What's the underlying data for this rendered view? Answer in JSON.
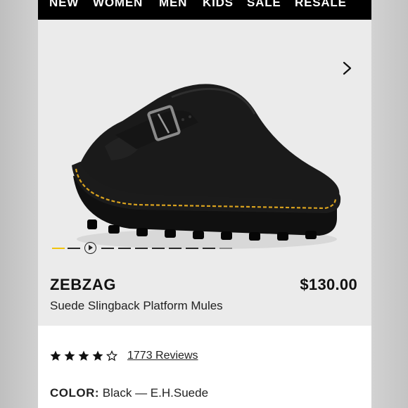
{
  "nav": {
    "items": [
      "NEW",
      "WOMEN",
      "MEN",
      "KIDS",
      "SALE",
      "RESALE"
    ]
  },
  "product": {
    "name": "ZEBZAG",
    "price": "$130.00",
    "subtitle": "Suede Slingback Platform Mules",
    "rating": 4.5,
    "reviews_label": "1773 Reviews",
    "color_label": "COLOR:",
    "color_value": "Black — E.H.Suede"
  },
  "gallery": {
    "slide_count": 11,
    "active_index": 0
  },
  "icons": {
    "next": "chevron-right-icon",
    "play": "play-icon",
    "star": "star-icon"
  },
  "colors": {
    "accent": "#f1c40f",
    "nav_bg": "#000000",
    "gallery_bg": "#ebebeb"
  }
}
